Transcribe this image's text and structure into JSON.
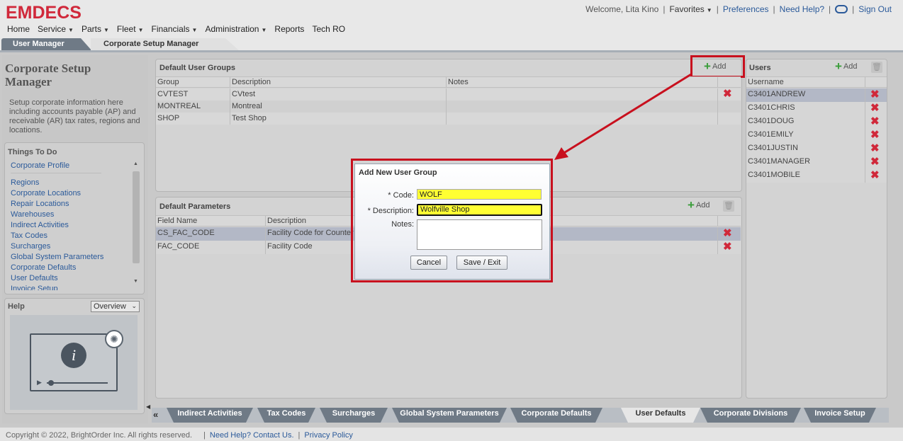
{
  "header": {
    "logo": "EMDECS",
    "welcome": "Welcome, Lita Kino",
    "favorites": "Favorites",
    "preferences": "Preferences",
    "need_help": "Need Help?",
    "sign_out": "Sign Out"
  },
  "nav": {
    "items": [
      {
        "label": "Home",
        "dropdown": false
      },
      {
        "label": "Service",
        "dropdown": true
      },
      {
        "label": "Parts",
        "dropdown": true
      },
      {
        "label": "Fleet",
        "dropdown": true
      },
      {
        "label": "Financials",
        "dropdown": true
      },
      {
        "label": "Administration",
        "dropdown": true
      },
      {
        "label": "Reports",
        "dropdown": false
      },
      {
        "label": "Tech RO",
        "dropdown": false
      }
    ]
  },
  "tabs": {
    "user_manager": "User Manager",
    "corporate_setup_manager": "Corporate Setup Manager"
  },
  "left": {
    "title": "Corporate Setup Manager",
    "description": "Setup corporate information here including accounts payable (AP) and receivable (AR) tax rates, regions and locations.",
    "todo_title": "Things To Do",
    "todo_first": "Corporate Profile",
    "todo_items": [
      "Regions",
      "Corporate Locations",
      "Repair Locations",
      "Warehouses",
      "Indirect Activities",
      "Tax Codes",
      "Surcharges",
      "Global System Parameters",
      "Corporate Defaults",
      "User Defaults",
      "Invoice Setup"
    ],
    "help_title": "Help",
    "help_select": "Overview"
  },
  "groups": {
    "title": "Default User Groups",
    "add": "Add",
    "columns": [
      "Group",
      "Description",
      "Notes"
    ],
    "rows": [
      {
        "group": "CVTEST",
        "description": "CVtest",
        "notes": ""
      },
      {
        "group": "MONTREAL",
        "description": "Montreal",
        "notes": ""
      },
      {
        "group": "SHOP",
        "description": "Test Shop",
        "notes": ""
      }
    ]
  },
  "params": {
    "title": "Default Parameters",
    "add": "Add",
    "columns": [
      "Field Name",
      "Description"
    ],
    "rows": [
      {
        "field": "CS_FAC_CODE",
        "description": "Facility Code for Counter"
      },
      {
        "field": "FAC_CODE",
        "description": "Facility Code"
      }
    ]
  },
  "users": {
    "title": "Users",
    "add": "Add",
    "column": "Username",
    "rows": [
      "C3401ANDREW",
      "C3401CHRIS",
      "C3401DOUG",
      "C3401EMILY",
      "C3401JUSTIN",
      "C3401MANAGER",
      "C3401MOBILE"
    ]
  },
  "modal": {
    "title": "Add New User Group",
    "code_label": "* Code:",
    "code_value": "WOLF",
    "description_label": "* Description:",
    "description_value": "Wolfville Shop",
    "notes_label": "Notes:",
    "cancel": "Cancel",
    "save": "Save / Exit"
  },
  "bottom_tabs": {
    "prev": "«",
    "items": [
      "Indirect Activities",
      "Tax Codes",
      "Surcharges",
      "Global System Parameters",
      "Corporate Defaults",
      "User Defaults",
      "Corporate Divisions",
      "Invoice Setup"
    ],
    "active": "User Defaults"
  },
  "footer": {
    "copyright": "Copyright © 2022, BrightOrder Inc. All rights reserved.",
    "help": "Need Help? Contact Us.",
    "privacy": "Privacy Policy"
  },
  "colors": {
    "brand_red": "#d0283a",
    "link_blue": "#2b5a9a",
    "highlight_yellow": "#ffff33",
    "annotation_red": "#c8101e"
  }
}
